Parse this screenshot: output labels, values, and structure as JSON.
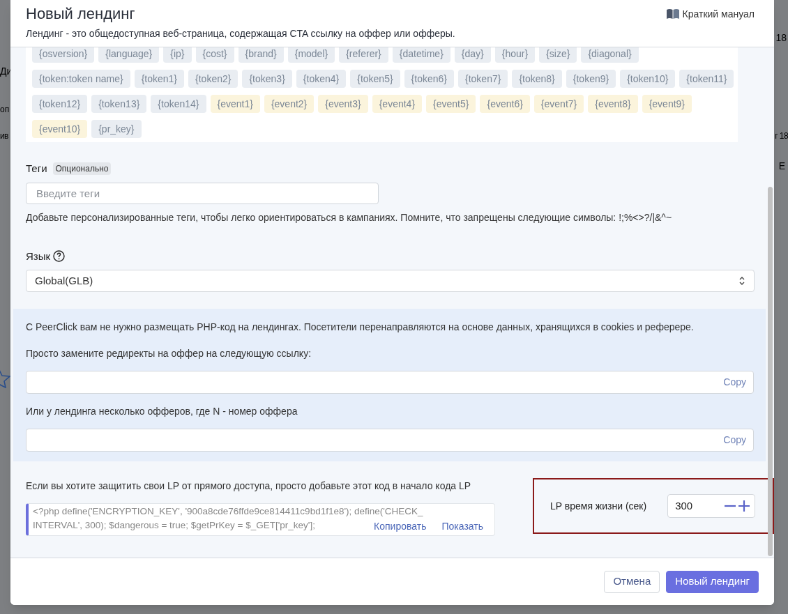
{
  "background": {
    "fragments": [
      "18",
      "Ди",
      "оп",
      "ив",
      "г 18",
      "E"
    ]
  },
  "modal": {
    "title": "Новый лендинг",
    "subtitle": "Лендинг - это общедоступная веб-страница, содержащая CTA ссылку на оффер или офферы.",
    "manual_link": "Краткий мануал"
  },
  "tokens": [
    {
      "label": "{osversion}",
      "kind": "token"
    },
    {
      "label": "{language}",
      "kind": "token"
    },
    {
      "label": "{ip}",
      "kind": "token"
    },
    {
      "label": "{cost}",
      "kind": "token"
    },
    {
      "label": "{brand}",
      "kind": "token"
    },
    {
      "label": "{model}",
      "kind": "token"
    },
    {
      "label": "{referer}",
      "kind": "token"
    },
    {
      "label": "{datetime}",
      "kind": "token"
    },
    {
      "label": "{day}",
      "kind": "token"
    },
    {
      "label": "{hour}",
      "kind": "token"
    },
    {
      "label": "{size}",
      "kind": "token"
    },
    {
      "label": "{diagonal}",
      "kind": "token"
    },
    {
      "label": "{token:token name}",
      "kind": "token"
    },
    {
      "label": "{token1}",
      "kind": "token"
    },
    {
      "label": "{token2}",
      "kind": "token"
    },
    {
      "label": "{token3}",
      "kind": "token"
    },
    {
      "label": "{token4}",
      "kind": "token"
    },
    {
      "label": "{token5}",
      "kind": "token"
    },
    {
      "label": "{token6}",
      "kind": "token"
    },
    {
      "label": "{token7}",
      "kind": "token"
    },
    {
      "label": "{token8}",
      "kind": "token"
    },
    {
      "label": "{token9}",
      "kind": "token"
    },
    {
      "label": "{token10}",
      "kind": "token"
    },
    {
      "label": "{token11}",
      "kind": "token"
    },
    {
      "label": "{token12}",
      "kind": "token"
    },
    {
      "label": "{token13}",
      "kind": "token"
    },
    {
      "label": "{token14}",
      "kind": "token"
    },
    {
      "label": "{event1}",
      "kind": "event"
    },
    {
      "label": "{event2}",
      "kind": "event"
    },
    {
      "label": "{event3}",
      "kind": "event"
    },
    {
      "label": "{event4}",
      "kind": "event"
    },
    {
      "label": "{event5}",
      "kind": "event"
    },
    {
      "label": "{event6}",
      "kind": "event"
    },
    {
      "label": "{event7}",
      "kind": "event"
    },
    {
      "label": "{event8}",
      "kind": "event"
    },
    {
      "label": "{event9}",
      "kind": "event"
    },
    {
      "label": "{event10}",
      "kind": "event"
    },
    {
      "label": "{pr_key}",
      "kind": "token"
    }
  ],
  "tags": {
    "label": "Теги",
    "badge": "Опционально",
    "placeholder": "Введите теги",
    "hint": "Добавьте персонализированные теги, чтобы легко ориентироваться в кампаниях. Помните, что запрещены следующие символы: !;%<>?/|&^~"
  },
  "language": {
    "label": "Язык",
    "value": "Global(GLB)"
  },
  "redirect_panel": {
    "intro": "С PeerClick вам не нужно размещать PHP-код на лендингах. Посетители перенаправляются на основе данных, хранящихся в cookies и реферере.",
    "fields": [
      {
        "label": "Просто замените редиректы на оффер на следующую ссылку:",
        "action": "Copy"
      },
      {
        "label": "Или у лендинга несколько офферов, где N - номер оффера",
        "action": "Copy"
      }
    ]
  },
  "protection": {
    "label": "Если вы хотите защитить свои LP от прямого доступа, просто добавьте этот код в начало кода LP",
    "code_lines": [
      "<?php define('ENCRYPTION_KEY', '900a8cde76ffde9ce814411c9bd1f1e8'); define('CHECK_",
      "INTERVAL', 300); $dangerous = true; $getPrKey = $_GET['pr_key'];"
    ],
    "copy": "Копировать",
    "show": "Показать"
  },
  "lifetime": {
    "label": "LP время жизни (сек)",
    "value": "300"
  },
  "buttons": [
    {
      "label": "Отмена",
      "kind": "secondary"
    },
    {
      "label": "Новый лендинг",
      "kind": "primary"
    }
  ]
}
